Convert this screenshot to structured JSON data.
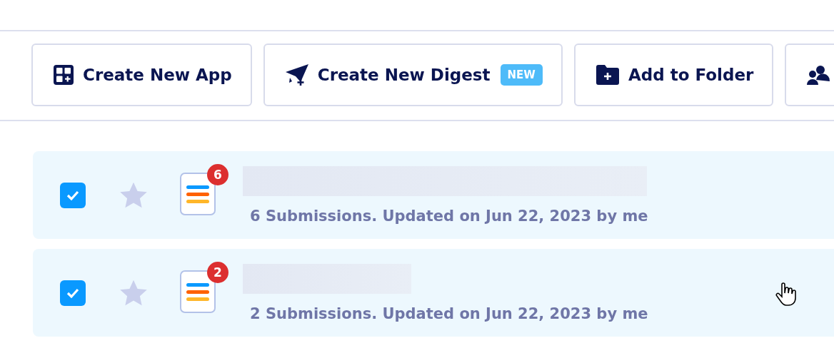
{
  "toolbar": [
    {
      "kind": "app",
      "label": "Create New App"
    },
    {
      "kind": "digest",
      "label": "Create New Digest",
      "badge": "NEW"
    },
    {
      "kind": "folder",
      "label": "Add to Folder"
    },
    {
      "kind": "users"
    }
  ],
  "forms": [
    {
      "checked": true,
      "starred": false,
      "count": "6",
      "meta": "6 Submissions. Updated on Jun 22, 2023 by me"
    },
    {
      "checked": true,
      "starred": false,
      "count": "2",
      "meta": "2 Submissions. Updated on Jun 22, 2023 by me"
    }
  ]
}
